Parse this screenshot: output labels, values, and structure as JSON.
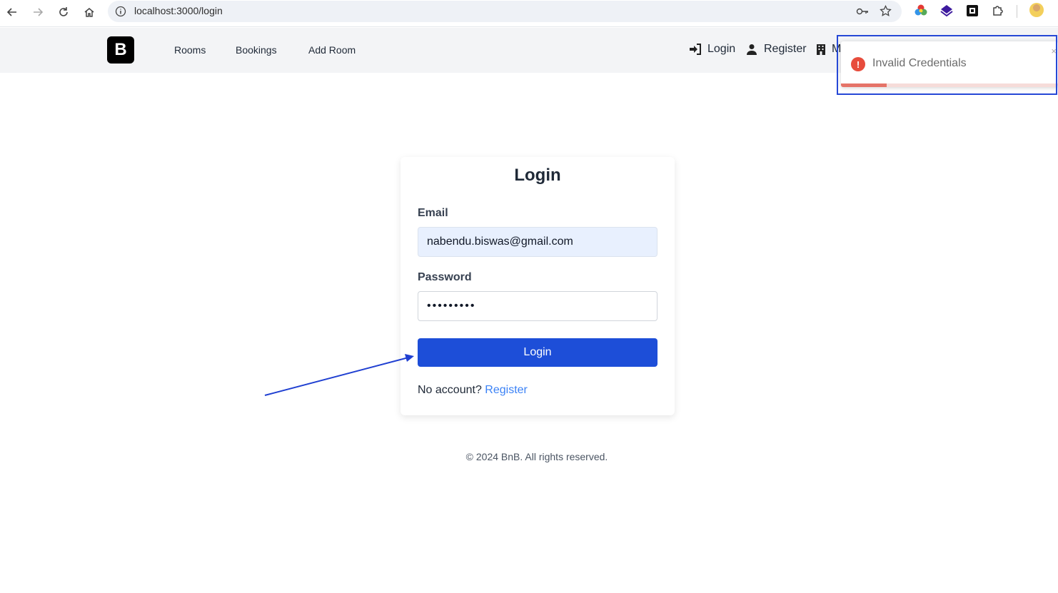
{
  "browser": {
    "url": "localhost:3000/login"
  },
  "navbar": {
    "logo_letter": "B",
    "links": [
      "Rooms",
      "Bookings",
      "Add Room"
    ],
    "login_label": "Login",
    "register_label": "Register",
    "truncated_label": "M"
  },
  "toast": {
    "message": "Invalid Credentials",
    "close": "×",
    "progress": 0.21,
    "color_error": "#e74c3c"
  },
  "login": {
    "title": "Login",
    "email_label": "Email",
    "email_value": "nabendu.biswas@gmail.com",
    "password_label": "Password",
    "password_value": "•••••••••",
    "submit_label": "Login",
    "no_account_text": "No account?",
    "register_link": "Register",
    "accent_color": "#1d4ed8"
  },
  "footer": {
    "copyright": "© 2024 BnB. All rights reserved."
  }
}
